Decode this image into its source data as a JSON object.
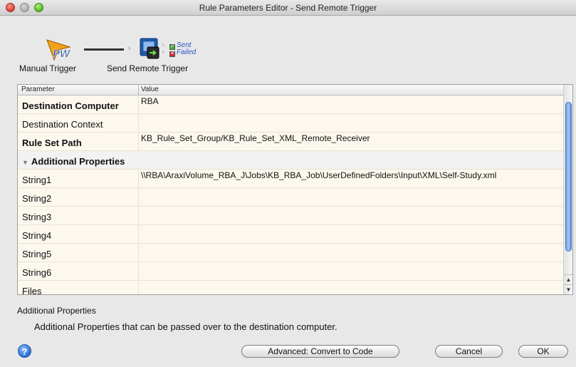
{
  "window": {
    "title": "Rule Parameters Editor - Send Remote Trigger"
  },
  "flow": {
    "nodes": [
      {
        "label": "Manual Trigger",
        "icon": "pw-trigger-icon"
      },
      {
        "label": "Send Remote Trigger",
        "icon": "send-remote-trigger-icon"
      }
    ],
    "status": {
      "sent": "Sent",
      "failed": "Failed"
    }
  },
  "table": {
    "columns": [
      "Parameter",
      "Value"
    ],
    "rows": [
      {
        "param": "Destination Computer",
        "value": "RBA",
        "bold": true
      },
      {
        "param": "Destination Context",
        "value": "",
        "bold": false
      },
      {
        "param": "Rule Set Path",
        "value": "KB_Rule_Set_Group/KB_Rule_Set_XML_Remote_Receiver",
        "bold": true
      },
      {
        "group": "Additional Properties"
      },
      {
        "param": "String1",
        "value": "\\\\RBA\\AraxiVolume_RBA_J\\Jobs\\KB_RBA_Job\\UserDefinedFolders\\Input\\XML\\Self-Study.xml",
        "bold": false
      },
      {
        "param": "String2",
        "value": "",
        "bold": false
      },
      {
        "param": "String3",
        "value": "",
        "bold": false
      },
      {
        "param": "String4",
        "value": "",
        "bold": false
      },
      {
        "param": "String5",
        "value": "",
        "bold": false
      },
      {
        "param": "String6",
        "value": "",
        "bold": false
      },
      {
        "param": "Files",
        "value": "",
        "bold": false
      }
    ]
  },
  "description": {
    "title": "Additional Properties",
    "text": "Additional Properties that can be passed over to the destination computer."
  },
  "buttons": {
    "help": "?",
    "advanced": "Advanced: Convert to Code",
    "cancel": "Cancel",
    "ok": "OK"
  },
  "colors": {
    "row_bg": "#fcf8ee",
    "accent": "#2f73d9",
    "status_sent": "#3db23d",
    "status_failed": "#d32a2a"
  }
}
